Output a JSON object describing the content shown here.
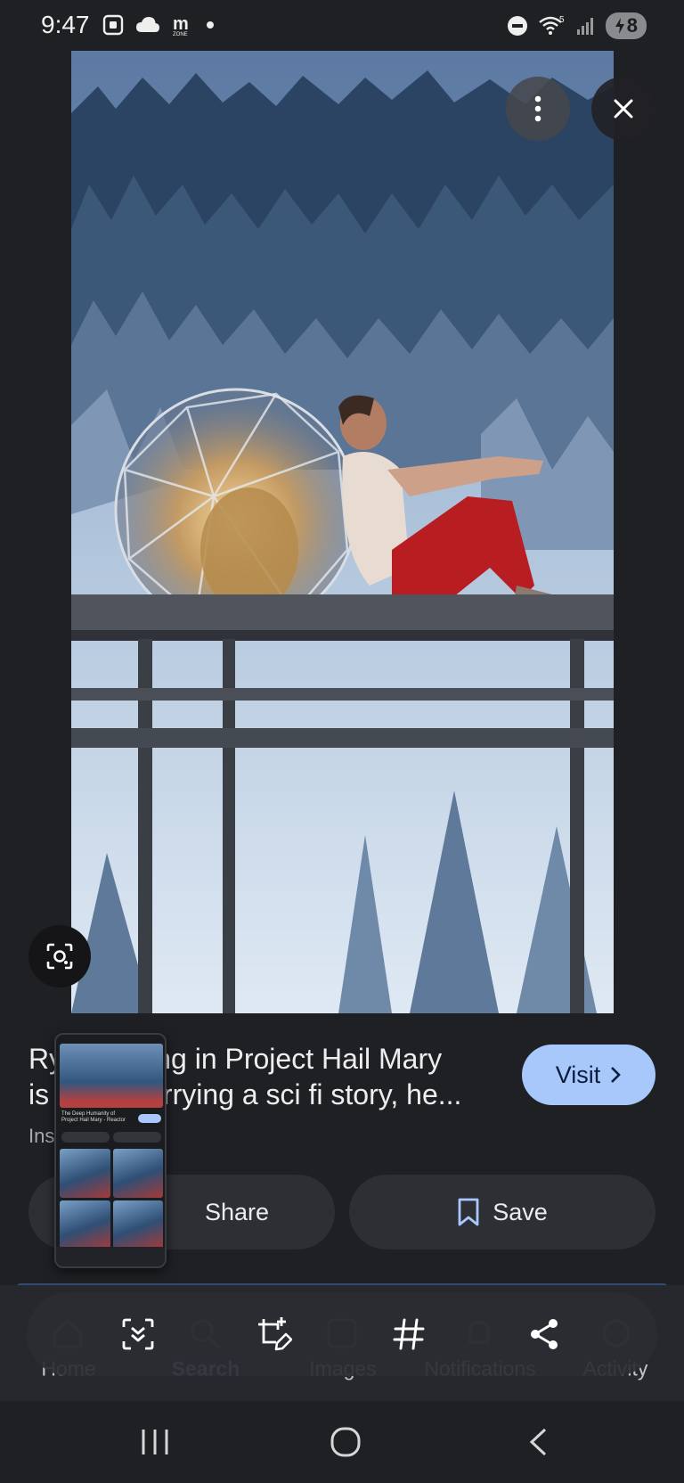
{
  "status_bar": {
    "time": "9:47",
    "battery": "8",
    "icons_left": [
      "screen-record-icon",
      "cloud-icon",
      "m-zone-icon",
      "dot-icon"
    ],
    "icons_right": [
      "do-not-disturb-icon",
      "wifi-icon",
      "signal-icon",
      "battery-icon"
    ],
    "wifi_badge": "5"
  },
  "result": {
    "title": "Ryan Gosling in Project Hail Mary isn't just carrying a sci fi story, he...",
    "title_visible_line1": "Ry ing in Project Hail Mary",
    "title_line1_start": "Ry",
    "title_line1_end": "ing in Project Hail Mary",
    "title_line2_start": "is",
    "title_line2_end": "arrying a sci fi story, he...",
    "source": "Ins",
    "visit_label": "Visit",
    "share_label": "Share",
    "save_label": "Save"
  },
  "thumbnail": {
    "title": "The Deep Humanity of Project Hail Mary - Reactor"
  },
  "bottom_nav": {
    "items": [
      {
        "label": "Home",
        "icon": "home-icon"
      },
      {
        "label": "Search",
        "icon": "search-icon",
        "active": true
      },
      {
        "label": "Images",
        "icon": "images-icon"
      },
      {
        "label": "Notifications",
        "icon": "bell-icon"
      },
      {
        "label": "Activity",
        "icon": "activity-icon"
      }
    ]
  },
  "screenshot_toolbar": [
    "scroll-capture-icon",
    "crop-edit-icon",
    "hashtag-icon",
    "share-icon"
  ],
  "colors": {
    "background": "#1f2024",
    "accent": "#a8c7fa",
    "button_bg": "#2e2f35"
  }
}
